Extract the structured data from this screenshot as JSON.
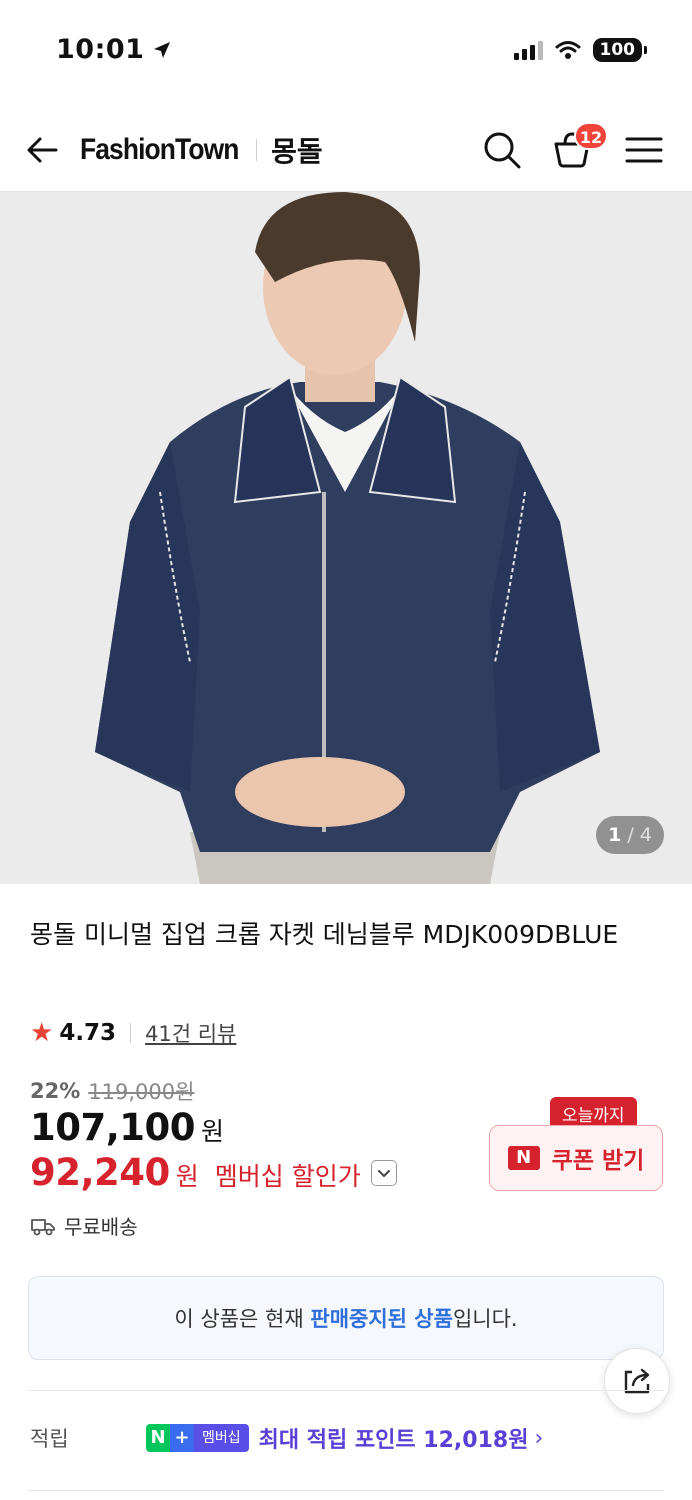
{
  "status_bar": {
    "time": "10:01",
    "battery": "100"
  },
  "header": {
    "brand": "FashionTown",
    "store": "몽돌",
    "cart_count": "12"
  },
  "gallery": {
    "current": "1",
    "total": "4"
  },
  "product": {
    "title": "몽돌 미니멀 집업 크롭 자켓 데님블루 MDJK009DBLUE",
    "rating": "4.73",
    "review_link": "41건 리뷰",
    "discount_rate": "22%",
    "original_price": "119,000원",
    "price": "107,100",
    "price_unit": "원",
    "member_price": "92,240",
    "member_unit": "원",
    "member_label": "멤버십 할인가",
    "shipping": "무료배송"
  },
  "coupon": {
    "tag": "오늘까지",
    "mark": "N",
    "label": "쿠폰 받기"
  },
  "notice": {
    "prefix": "이 상품은 현재 ",
    "highlight": "판매중지된 상품",
    "suffix": "입니다."
  },
  "points": {
    "label": "적립",
    "badge_n": "N",
    "badge_plus": "+",
    "badge_text": "멤버십",
    "text": "최대 적립 포인트 12,018원",
    "chevron": "›"
  },
  "colors": {
    "accent_red": "#d6222d",
    "naver_green": "#03c75a",
    "points_purple": "#5a3fd6",
    "notice_blue": "#2f6fdb"
  },
  "icons": [
    "location-arrow-icon",
    "signal-icon",
    "wifi-icon",
    "battery-icon",
    "back-arrow-icon",
    "search-icon",
    "cart-icon",
    "menu-icon",
    "star-icon",
    "chevron-down-icon",
    "truck-icon",
    "share-icon"
  ]
}
